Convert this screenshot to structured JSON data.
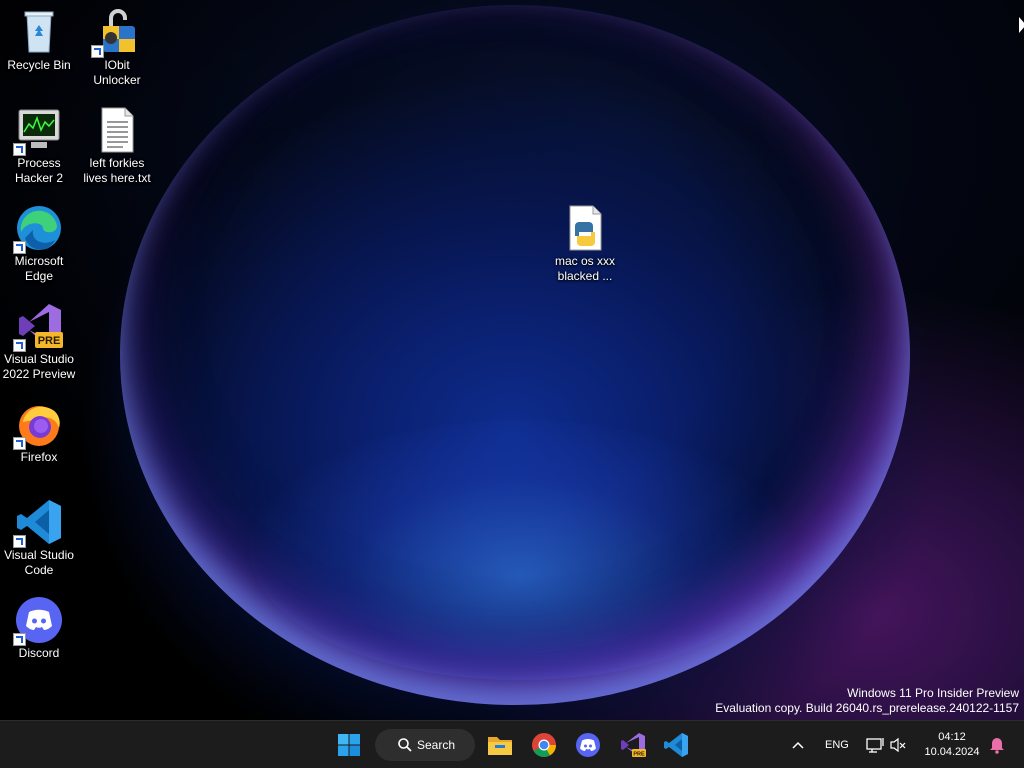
{
  "desktop": {
    "icons": [
      {
        "label": "Recycle Bin"
      },
      {
        "label": "IObit\nUnlocker"
      },
      {
        "label": "Process\nHacker 2"
      },
      {
        "label": "left forkies\nlives here.txt"
      },
      {
        "label": "Microsoft\nEdge"
      },
      {
        "label": "Visual Studio\n2022 Preview"
      },
      {
        "label": "Firefox"
      },
      {
        "label": "Visual Studio\nCode"
      },
      {
        "label": "Discord"
      },
      {
        "label": "mac os xxx\nblacked ..."
      }
    ],
    "watermark": {
      "line1": "Windows 11 Pro Insider Preview",
      "line2": "Evaluation copy. Build 26040.rs_prerelease.240122-1157"
    }
  },
  "taskbar": {
    "search_label": "Search",
    "pinned": [
      "start-icon",
      "file-explorer-icon",
      "chrome-icon",
      "discord-icon",
      "visual-studio-preview-icon",
      "vscode-icon"
    ],
    "tray": {
      "language": "ENG",
      "time": "04:12",
      "date": "10.04.2024"
    }
  },
  "colors": {
    "taskbar": "#1c1c1c",
    "accent": "#0078d4",
    "vs_purple": "#8c5fd6",
    "discord": "#5865f2"
  }
}
